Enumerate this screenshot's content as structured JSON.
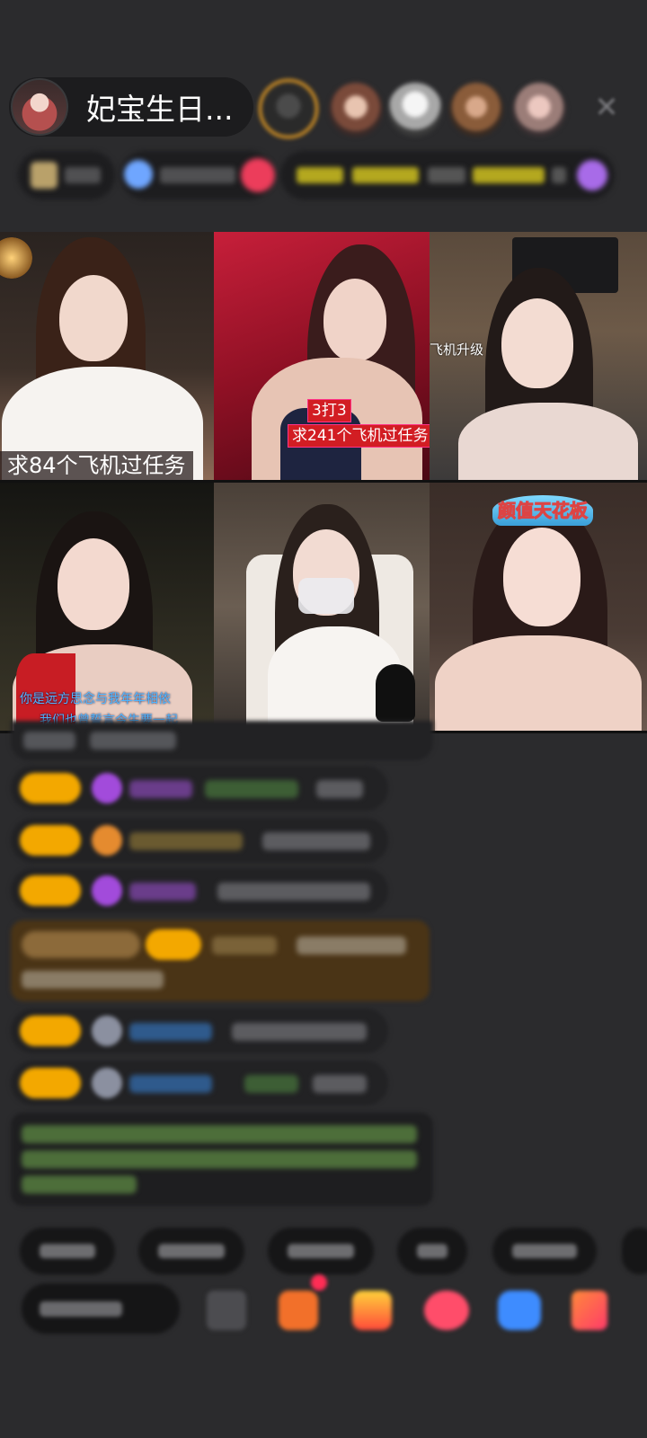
{
  "header": {
    "host_name": "妃宝生日...",
    "close_icon": "close-icon"
  },
  "videos": [
    {
      "caption": "求84个飞机过任务"
    },
    {
      "label_top": "3打3",
      "label_bottom": "求241个飞机过任务"
    },
    {
      "label": "飞机升级"
    },
    {
      "lyric_line1": "你是远方思念与我年年相依",
      "lyric_line2": "我们也曾誓言今生要一起"
    },
    {},
    {
      "crown_text": "颜值天花板"
    }
  ],
  "colors": {
    "background": "#2b2b2d",
    "badge_gold": "#f3a800",
    "chat_name_blue": "#3a7bd5",
    "system_message_green": "#8fd35f",
    "highlight_message_brown": "#4a3416"
  }
}
